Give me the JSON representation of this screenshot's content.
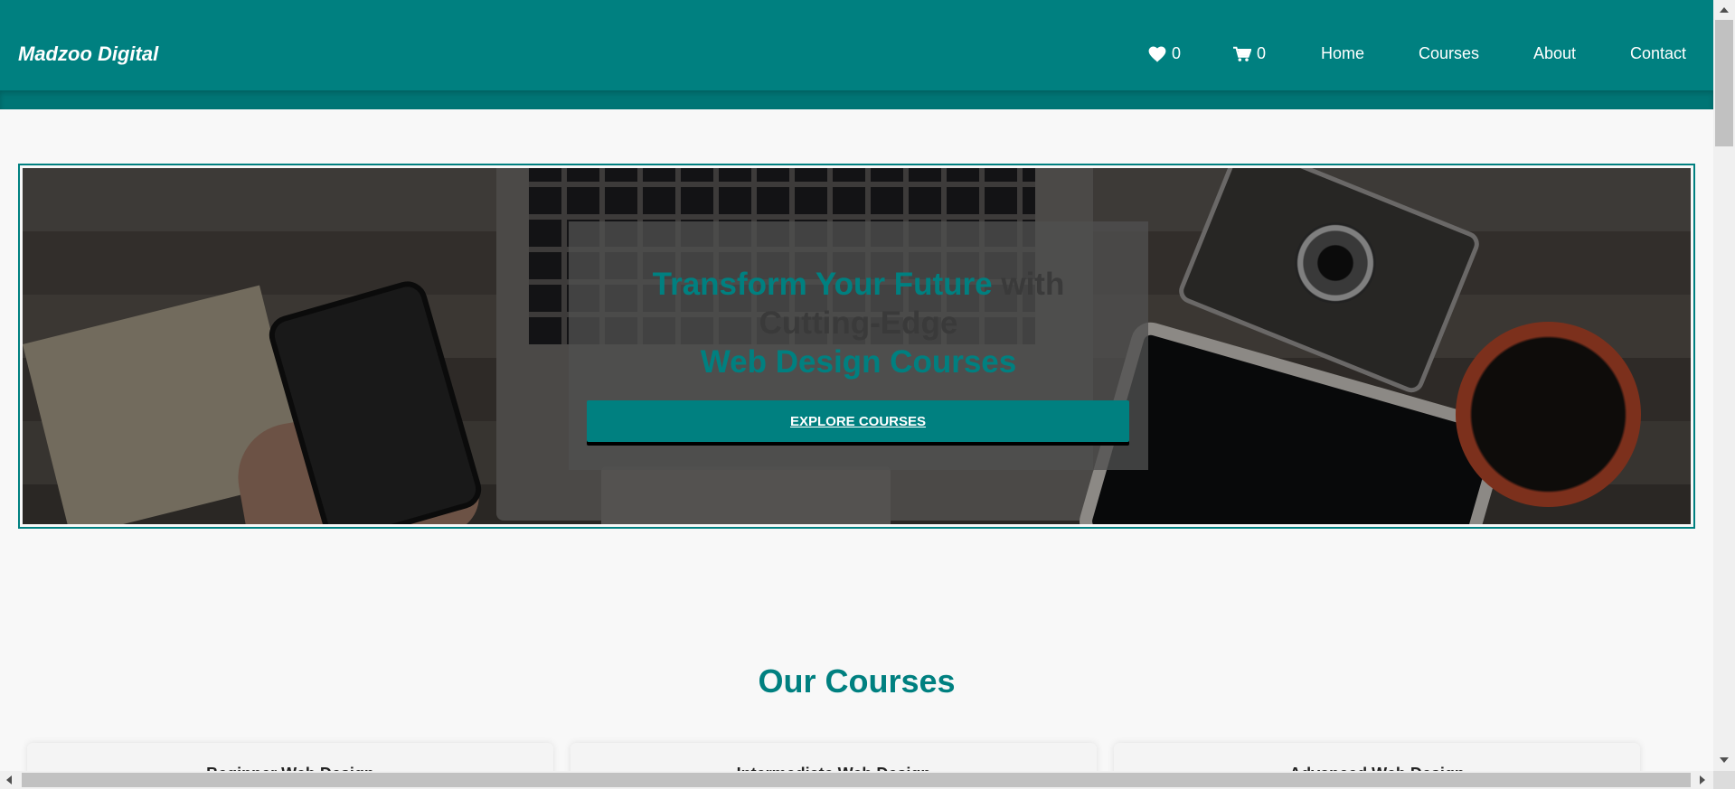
{
  "header": {
    "logo": "Madzoo Digital",
    "wishlist_count": "0",
    "cart_count": "0",
    "nav": [
      {
        "label": "Home"
      },
      {
        "label": "Courses"
      },
      {
        "label": "About"
      },
      {
        "label": "Contact"
      }
    ]
  },
  "hero": {
    "title_part1": "Transform Your Future",
    "title_part2": " with",
    "title_line2": "Cutting-Edge",
    "title_line3": "Web Design Courses",
    "button_label": "EXPLORE COURSES"
  },
  "courses": {
    "heading": "Our Courses",
    "items": [
      {
        "title": "Beginner Web Design"
      },
      {
        "title": "Intermediate Web Design"
      },
      {
        "title": "Advanced Web Design"
      }
    ]
  },
  "colors": {
    "brand": "#008080",
    "background": "#f8f8f8",
    "text_white": "#ffffff"
  },
  "icons": {
    "wishlist": "heart-icon",
    "cart": "cart-icon"
  }
}
